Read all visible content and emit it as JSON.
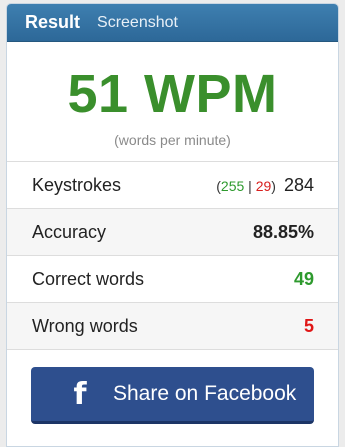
{
  "header": {
    "tab_result": "Result",
    "tab_screenshot": "Screenshot"
  },
  "speed": {
    "value": "51 WPM",
    "unit": "(words per minute)"
  },
  "stats": {
    "keystrokes": {
      "label": "Keystrokes",
      "open": "(",
      "correct": "255",
      "sep": " | ",
      "wrong": "29",
      "close": ")",
      "total": "284"
    },
    "accuracy": {
      "label": "Accuracy",
      "value": "88.85%"
    },
    "correct_words": {
      "label": "Correct words",
      "value": "49"
    },
    "wrong_words": {
      "label": "Wrong words",
      "value": "5"
    }
  },
  "share": {
    "icon": "facebook-icon",
    "label": "Share on Facebook"
  },
  "colors": {
    "header": "#2d6898",
    "wpm": "#3a8f2c",
    "correct": "#2e9a2e",
    "wrong": "#e01616",
    "facebook": "#2e4f8e"
  }
}
